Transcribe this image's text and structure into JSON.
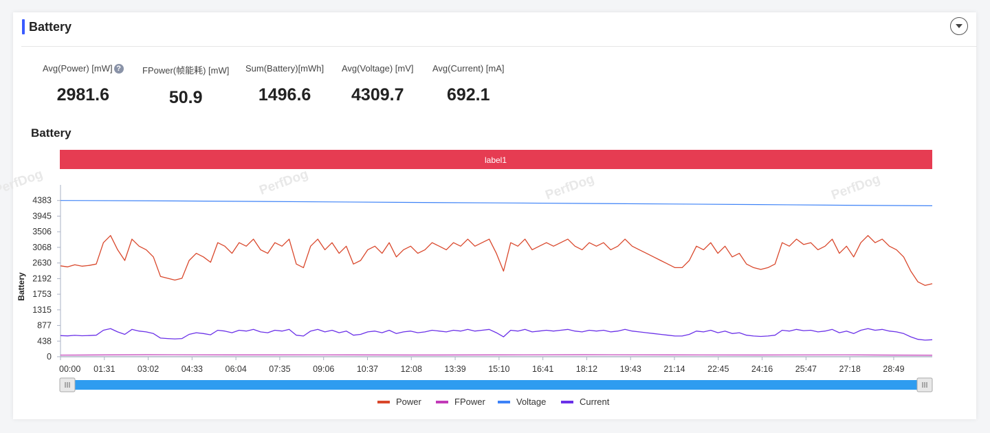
{
  "header": {
    "title": "Battery"
  },
  "stats": [
    {
      "label": "Avg(Power) [mW]",
      "value": "2981.6",
      "help": "?"
    },
    {
      "label": "FPower(帧能耗) [mW]",
      "value": "50.9"
    },
    {
      "label": "Sum(Battery)[mWh]",
      "value": "1496.6"
    },
    {
      "label": "Avg(Voltage) [mV]",
      "value": "4309.7"
    },
    {
      "label": "Avg(Current) [mA]",
      "value": "692.1"
    }
  ],
  "watermark": "PerfDog",
  "chart_data": {
    "type": "line",
    "title": "Battery",
    "ylabel": "Battery",
    "xlabel": "",
    "annotation_band": {
      "label": "label1",
      "color": "#e63c52"
    },
    "ylim": [
      0,
      4821
    ],
    "yticks": [
      "0",
      "438",
      "877",
      "1315",
      "1753",
      "2192",
      "2630",
      "3068",
      "3506",
      "3945",
      "4383"
    ],
    "ytick_values": [
      0,
      438.3,
      876.6,
      1314.9,
      1753.2,
      2191.5,
      2629.8,
      3068.1,
      3506.4,
      3944.7,
      4383
    ],
    "xlim_seconds": [
      0,
      1809
    ],
    "xticks": [
      "00:00",
      "01:31",
      "03:02",
      "04:33",
      "06:04",
      "07:35",
      "09:06",
      "10:37",
      "12:08",
      "13:39",
      "15:10",
      "16:41",
      "18:12",
      "19:43",
      "21:14",
      "22:45",
      "24:16",
      "25:47",
      "27:18",
      "28:49"
    ],
    "xtick_step_seconds": 91,
    "grid": false,
    "legend_position": "bottom",
    "series": [
      {
        "name": "Power",
        "color": "#d9472b",
        "values": [
          2550,
          2520,
          2580,
          2540,
          2560,
          2600,
          3200,
          3400,
          3000,
          2700,
          3300,
          3100,
          3000,
          2800,
          2250,
          2200,
          2150,
          2200,
          2700,
          2900,
          2800,
          2650,
          3200,
          3100,
          2900,
          3200,
          3100,
          3300,
          3000,
          2900,
          3200,
          3100,
          3300,
          2600,
          2500,
          3100,
          3300,
          3000,
          3200,
          2900,
          3100,
          2600,
          2700,
          3000,
          3100,
          2900,
          3200,
          2800,
          3000,
          3100,
          2900,
          3000,
          3200,
          3100,
          3000,
          3200,
          3100,
          3300,
          3100,
          3200,
          3300,
          2900,
          2400,
          3200,
          3100,
          3300,
          3000,
          3100,
          3200,
          3100,
          3200,
          3300,
          3100,
          3000,
          3200,
          3100,
          3200,
          3000,
          3100,
          3300,
          3100,
          3000,
          2900,
          2800,
          2700,
          2600,
          2500,
          2500,
          2700,
          3100,
          3000,
          3200,
          2900,
          3100,
          2800,
          2900,
          2600,
          2500,
          2450,
          2500,
          2600,
          3200,
          3100,
          3300,
          3150,
          3200,
          3000,
          3100,
          3300,
          2900,
          3100,
          2800,
          3200,
          3400,
          3200,
          3300,
          3100,
          3000,
          2800,
          2400,
          2100,
          2000,
          2050
        ]
      },
      {
        "name": "FPower",
        "color": "#c23ab8",
        "values": [
          45,
          55,
          50,
          52,
          48,
          50,
          55,
          50,
          48,
          52,
          40
        ]
      },
      {
        "name": "Voltage",
        "color": "#3d82f7",
        "values": [
          4383,
          4375,
          4360,
          4345,
          4330,
          4315,
          4300,
          4285,
          4270,
          4250,
          4235
        ]
      },
      {
        "name": "Current",
        "color": "#6a30e8",
        "values": [
          592,
          585,
          599,
          589,
          594,
          603,
          742,
          789,
          696,
          626,
          766,
          719,
          696,
          650,
          522,
          510,
          499,
          510,
          626,
          673,
          650,
          615,
          742,
          719,
          673,
          742,
          719,
          766,
          696,
          673,
          742,
          719,
          766,
          603,
          580,
          719,
          766,
          696,
          742,
          673,
          719,
          603,
          626,
          696,
          719,
          673,
          742,
          650,
          696,
          719,
          673,
          696,
          742,
          719,
          696,
          742,
          719,
          766,
          719,
          742,
          766,
          673,
          557,
          742,
          719,
          766,
          696,
          719,
          742,
          719,
          742,
          766,
          719,
          696,
          742,
          719,
          742,
          696,
          719,
          766,
          719,
          696,
          673,
          650,
          626,
          603,
          580,
          580,
          626,
          719,
          696,
          742,
          673,
          719,
          650,
          673,
          603,
          580,
          568,
          580,
          603,
          742,
          719,
          766,
          731,
          742,
          696,
          719,
          766,
          673,
          719,
          650,
          742,
          789,
          742,
          766,
          719,
          696,
          650,
          557,
          487,
          464,
          476
        ]
      }
    ]
  }
}
